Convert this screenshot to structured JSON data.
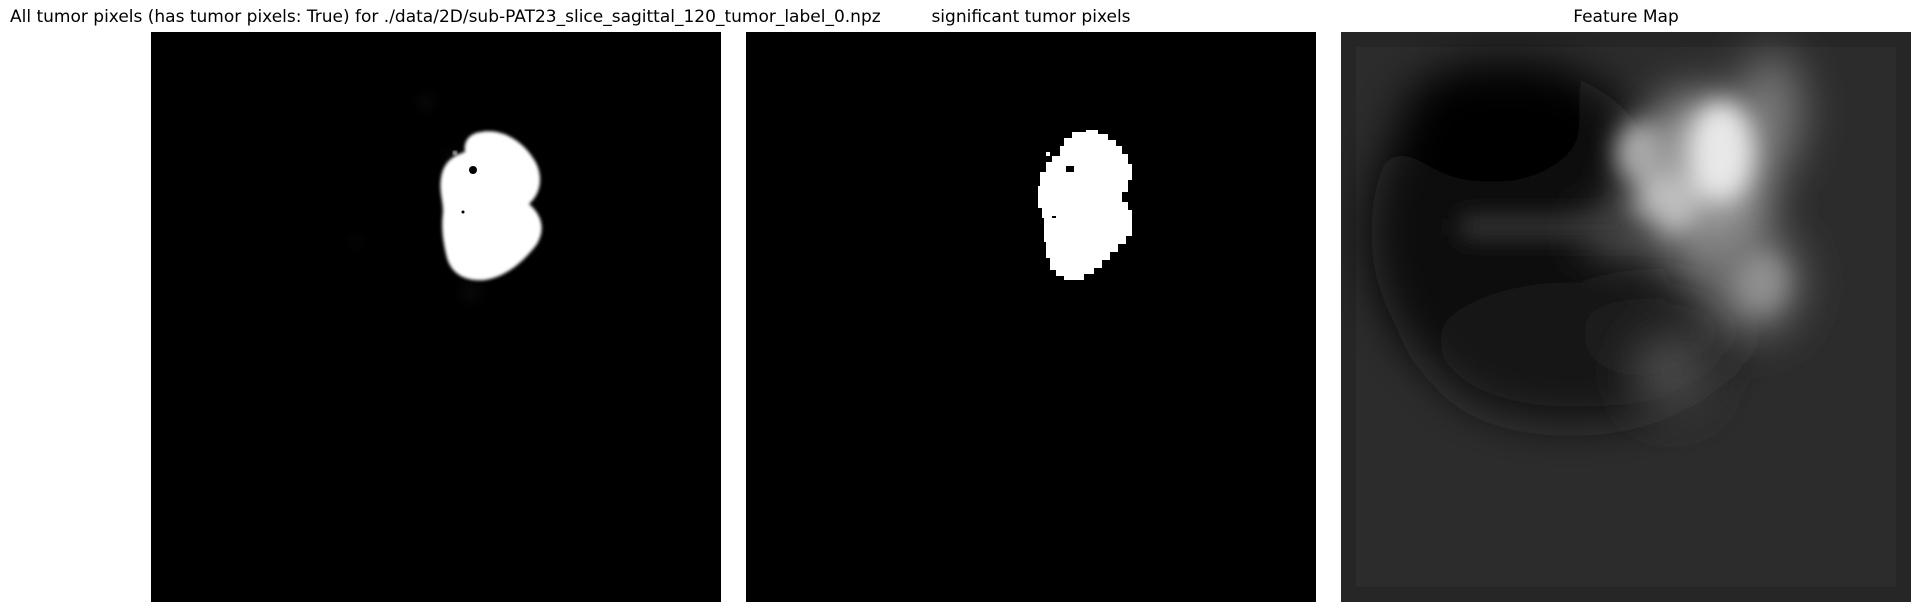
{
  "figure": {
    "panels": [
      {
        "title": "All tumor pixels (has tumor pixels: True) for ./data/2D/sub-PAT23_slice_sagittal_120_tumor_label_0.npz",
        "image": "grayscale tumor probability map, black background with white tumor blob"
      },
      {
        "title": "significant tumor pixels",
        "image": "binary tumor mask, black background with white pixelated blob"
      },
      {
        "title": "Feature Map",
        "image": "blurred grayscale feature activation map"
      }
    ]
  }
}
